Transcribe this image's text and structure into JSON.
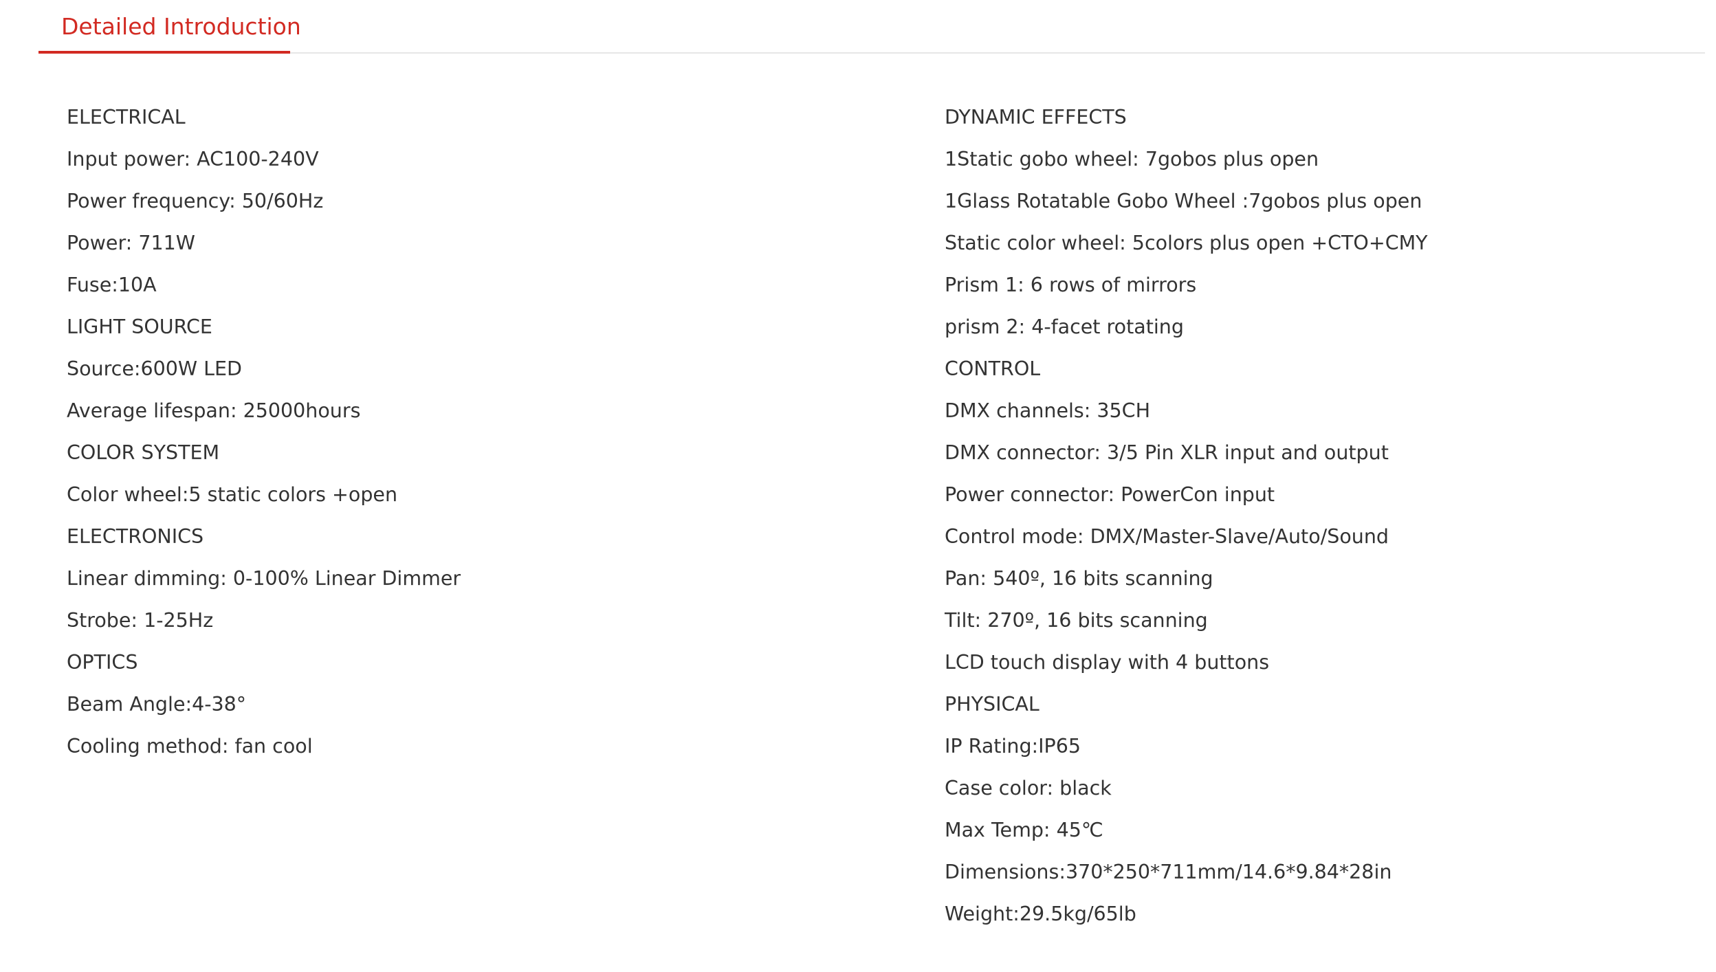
{
  "tab": {
    "label": "Detailed Introduction"
  },
  "colors": {
    "accent": "#d22a22",
    "text": "#333333",
    "divider": "#e6e6e6"
  },
  "left_column": [
    "ELECTRICAL",
    "Input power: AC100-240V",
    "Power frequency: 50/60Hz",
    "Power: 711W",
    "Fuse:10A",
    "LIGHT SOURCE",
    "Source:600W LED",
    "Average lifespan: 25000hours",
    "COLOR SYSTEM",
    "Color wheel:5 static colors +open",
    "ELECTRONICS",
    "Linear dimming: 0-100% Linear Dimmer",
    "Strobe: 1-25Hz",
    "OPTICS",
    "Beam Angle:4-38°",
    "Cooling method: fan cool"
  ],
  "right_column": [
    "DYNAMIC EFFECTS",
    "1Static gobo wheel: 7gobos plus open",
    "1Glass Rotatable Gobo Wheel :7gobos plus open",
    "Static color wheel: 5colors plus open +CTO+CMY",
    "Prism 1: 6 rows of mirrors",
    "prism 2: 4-facet rotating",
    "CONTROL",
    "DMX channels: 35CH",
    "DMX connector: 3/5 Pin XLR input and output",
    "Power connector: PowerCon input",
    "Control mode: DMX/Master-Slave/Auto/Sound",
    "Pan: 540º, 16 bits scanning",
    "Tilt: 270º, 16 bits scanning",
    "LCD touch display with 4 buttons",
    "PHYSICAL",
    "IP Rating:IP65",
    "Case color: black",
    "Max Temp: 45℃",
    "Dimensions:370*250*711mm/14.6*9.84*28in",
    "Weight:29.5kg/65lb"
  ]
}
